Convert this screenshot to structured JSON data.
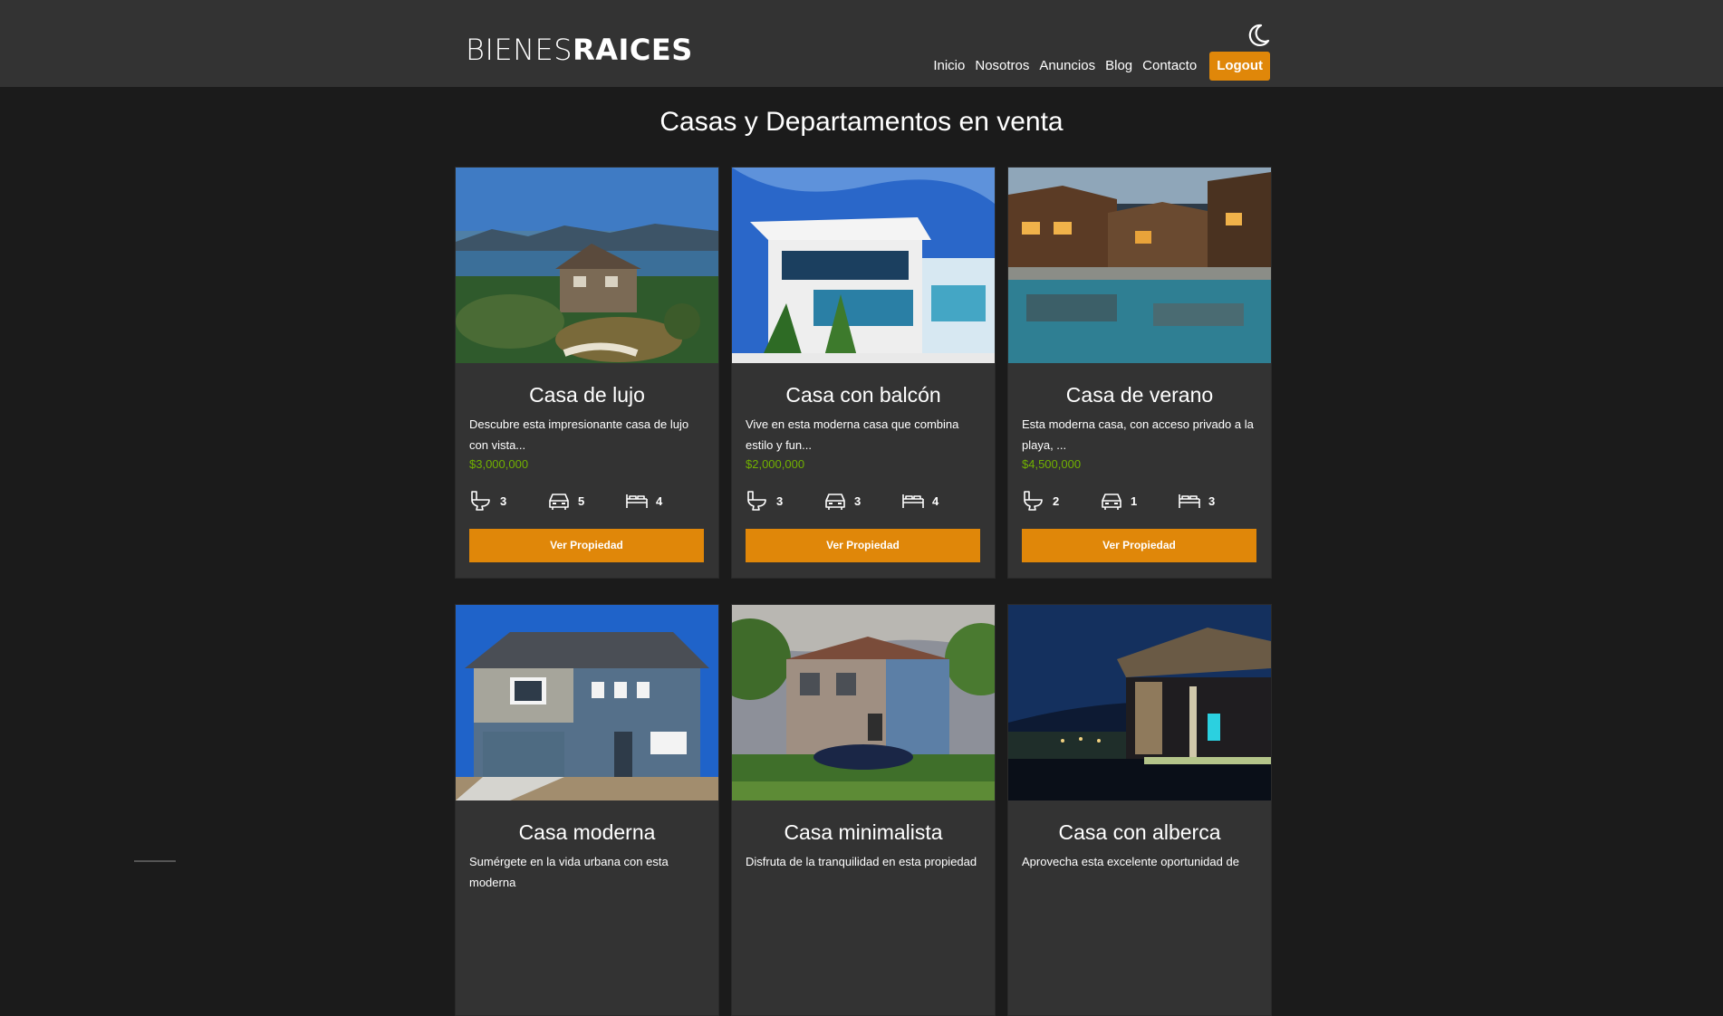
{
  "header": {
    "logo_light": "BIENES",
    "logo_bold": "RAICES",
    "dark_mode_icon": "moon-icon",
    "nav": [
      {
        "label": "Inicio"
      },
      {
        "label": "Nosotros"
      },
      {
        "label": "Anuncios"
      },
      {
        "label": "Blog"
      },
      {
        "label": "Contacto"
      }
    ],
    "logout_label": "Logout"
  },
  "main": {
    "title": "Casas y Departamentos en venta",
    "listings": [
      {
        "title": "Casa de lujo",
        "description": "Descubre esta impresionante casa de lujo con vista...",
        "price": "$3,000,000",
        "bathrooms": "3",
        "parking": "5",
        "bedrooms": "4",
        "button": "Ver Propiedad",
        "image_icon": "lake-house-photo"
      },
      {
        "title": "Casa con balcón",
        "description": "Vive en esta moderna casa que combina estilo y fun...",
        "price": "$2,000,000",
        "bathrooms": "3",
        "parking": "3",
        "bedrooms": "4",
        "button": "Ver Propiedad",
        "image_icon": "modern-house-photo"
      },
      {
        "title": "Casa de verano",
        "description": "Esta moderna casa, con acceso privado a la playa, ...",
        "price": "$4,500,000",
        "bathrooms": "2",
        "parking": "1",
        "bedrooms": "3",
        "button": "Ver Propiedad",
        "image_icon": "pool-lodge-photo"
      },
      {
        "title": "Casa moderna",
        "description": "Sumérgete en la vida urbana con esta moderna",
        "image_icon": "blue-house-photo"
      },
      {
        "title": "Casa minimalista",
        "description": "Disfruta de la tranquilidad en esta propiedad",
        "image_icon": "brick-house-photo"
      },
      {
        "title": "Casa con alberca",
        "description": "Aprovecha esta excelente oportunidad de",
        "image_icon": "night-house-photo"
      }
    ]
  },
  "colors": {
    "accent": "#e08709",
    "price": "#71b100",
    "header_bg": "#333333",
    "page_bg": "#1b1b1b"
  }
}
